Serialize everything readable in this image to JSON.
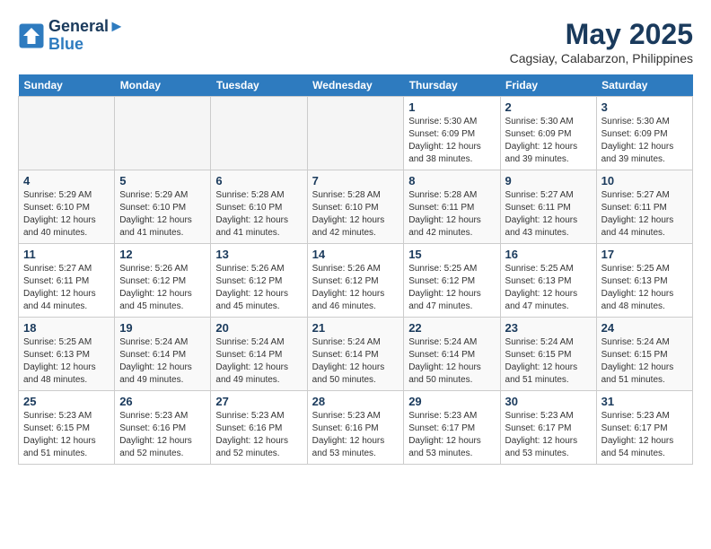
{
  "header": {
    "logo_line1": "General",
    "logo_line2": "Blue",
    "month_title": "May 2025",
    "location": "Cagsiay, Calabarzon, Philippines"
  },
  "days_of_week": [
    "Sunday",
    "Monday",
    "Tuesday",
    "Wednesday",
    "Thursday",
    "Friday",
    "Saturday"
  ],
  "weeks": [
    [
      {
        "day": "",
        "info": ""
      },
      {
        "day": "",
        "info": ""
      },
      {
        "day": "",
        "info": ""
      },
      {
        "day": "",
        "info": ""
      },
      {
        "day": "1",
        "info": "Sunrise: 5:30 AM\nSunset: 6:09 PM\nDaylight: 12 hours\nand 38 minutes."
      },
      {
        "day": "2",
        "info": "Sunrise: 5:30 AM\nSunset: 6:09 PM\nDaylight: 12 hours\nand 39 minutes."
      },
      {
        "day": "3",
        "info": "Sunrise: 5:30 AM\nSunset: 6:09 PM\nDaylight: 12 hours\nand 39 minutes."
      }
    ],
    [
      {
        "day": "4",
        "info": "Sunrise: 5:29 AM\nSunset: 6:10 PM\nDaylight: 12 hours\nand 40 minutes."
      },
      {
        "day": "5",
        "info": "Sunrise: 5:29 AM\nSunset: 6:10 PM\nDaylight: 12 hours\nand 41 minutes."
      },
      {
        "day": "6",
        "info": "Sunrise: 5:28 AM\nSunset: 6:10 PM\nDaylight: 12 hours\nand 41 minutes."
      },
      {
        "day": "7",
        "info": "Sunrise: 5:28 AM\nSunset: 6:10 PM\nDaylight: 12 hours\nand 42 minutes."
      },
      {
        "day": "8",
        "info": "Sunrise: 5:28 AM\nSunset: 6:11 PM\nDaylight: 12 hours\nand 42 minutes."
      },
      {
        "day": "9",
        "info": "Sunrise: 5:27 AM\nSunset: 6:11 PM\nDaylight: 12 hours\nand 43 minutes."
      },
      {
        "day": "10",
        "info": "Sunrise: 5:27 AM\nSunset: 6:11 PM\nDaylight: 12 hours\nand 44 minutes."
      }
    ],
    [
      {
        "day": "11",
        "info": "Sunrise: 5:27 AM\nSunset: 6:11 PM\nDaylight: 12 hours\nand 44 minutes."
      },
      {
        "day": "12",
        "info": "Sunrise: 5:26 AM\nSunset: 6:12 PM\nDaylight: 12 hours\nand 45 minutes."
      },
      {
        "day": "13",
        "info": "Sunrise: 5:26 AM\nSunset: 6:12 PM\nDaylight: 12 hours\nand 45 minutes."
      },
      {
        "day": "14",
        "info": "Sunrise: 5:26 AM\nSunset: 6:12 PM\nDaylight: 12 hours\nand 46 minutes."
      },
      {
        "day": "15",
        "info": "Sunrise: 5:25 AM\nSunset: 6:12 PM\nDaylight: 12 hours\nand 47 minutes."
      },
      {
        "day": "16",
        "info": "Sunrise: 5:25 AM\nSunset: 6:13 PM\nDaylight: 12 hours\nand 47 minutes."
      },
      {
        "day": "17",
        "info": "Sunrise: 5:25 AM\nSunset: 6:13 PM\nDaylight: 12 hours\nand 48 minutes."
      }
    ],
    [
      {
        "day": "18",
        "info": "Sunrise: 5:25 AM\nSunset: 6:13 PM\nDaylight: 12 hours\nand 48 minutes."
      },
      {
        "day": "19",
        "info": "Sunrise: 5:24 AM\nSunset: 6:14 PM\nDaylight: 12 hours\nand 49 minutes."
      },
      {
        "day": "20",
        "info": "Sunrise: 5:24 AM\nSunset: 6:14 PM\nDaylight: 12 hours\nand 49 minutes."
      },
      {
        "day": "21",
        "info": "Sunrise: 5:24 AM\nSunset: 6:14 PM\nDaylight: 12 hours\nand 50 minutes."
      },
      {
        "day": "22",
        "info": "Sunrise: 5:24 AM\nSunset: 6:14 PM\nDaylight: 12 hours\nand 50 minutes."
      },
      {
        "day": "23",
        "info": "Sunrise: 5:24 AM\nSunset: 6:15 PM\nDaylight: 12 hours\nand 51 minutes."
      },
      {
        "day": "24",
        "info": "Sunrise: 5:24 AM\nSunset: 6:15 PM\nDaylight: 12 hours\nand 51 minutes."
      }
    ],
    [
      {
        "day": "25",
        "info": "Sunrise: 5:23 AM\nSunset: 6:15 PM\nDaylight: 12 hours\nand 51 minutes."
      },
      {
        "day": "26",
        "info": "Sunrise: 5:23 AM\nSunset: 6:16 PM\nDaylight: 12 hours\nand 52 minutes."
      },
      {
        "day": "27",
        "info": "Sunrise: 5:23 AM\nSunset: 6:16 PM\nDaylight: 12 hours\nand 52 minutes."
      },
      {
        "day": "28",
        "info": "Sunrise: 5:23 AM\nSunset: 6:16 PM\nDaylight: 12 hours\nand 53 minutes."
      },
      {
        "day": "29",
        "info": "Sunrise: 5:23 AM\nSunset: 6:17 PM\nDaylight: 12 hours\nand 53 minutes."
      },
      {
        "day": "30",
        "info": "Sunrise: 5:23 AM\nSunset: 6:17 PM\nDaylight: 12 hours\nand 53 minutes."
      },
      {
        "day": "31",
        "info": "Sunrise: 5:23 AM\nSunset: 6:17 PM\nDaylight: 12 hours\nand 54 minutes."
      }
    ]
  ]
}
